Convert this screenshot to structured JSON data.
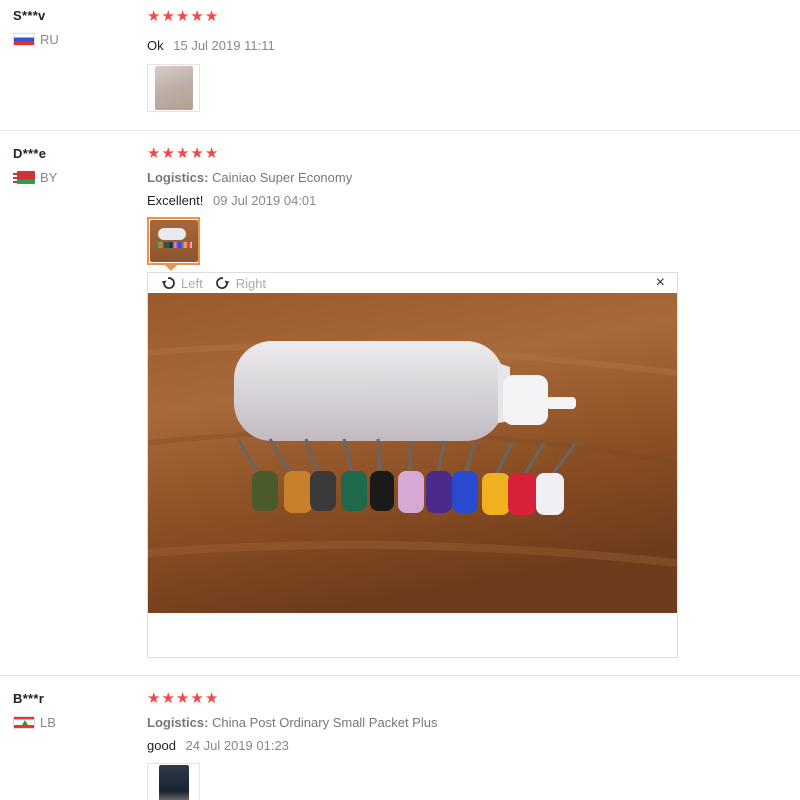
{
  "reviews": [
    {
      "user": "S***v",
      "country": "RU",
      "stars": 5,
      "feedback": "Ok",
      "date": "15 Jul 2019 11:11"
    },
    {
      "user": "D***e",
      "country": "BY",
      "stars": 5,
      "logistics_label": "Logistics:",
      "logistics": "Cainiao Super Economy",
      "feedback": "Excellent!",
      "date": "09 Jul 2019 04:01"
    },
    {
      "user": "B***r",
      "country": "LB",
      "stars": 5,
      "logistics_label": "Logistics:",
      "logistics": "China Post Ordinary Small Packet Plus",
      "feedback": "good",
      "date": "24 Jul 2019 01:23"
    }
  ],
  "viewer": {
    "rotate_left": "Left",
    "rotate_right": "Right",
    "close": "×"
  },
  "colors": {
    "star": "#f44848",
    "active_thumb_border": "#f19047"
  },
  "icons": {
    "rotate_left": "rotate-left-icon",
    "rotate_right": "rotate-right-icon",
    "close": "close-icon",
    "star": "star-icon"
  }
}
